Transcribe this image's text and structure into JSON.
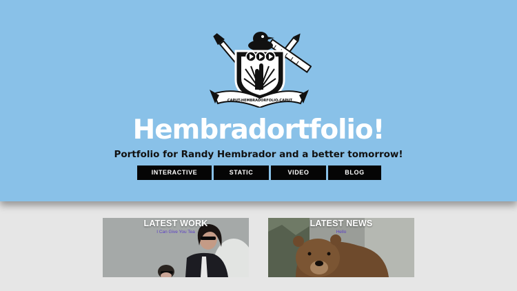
{
  "header": {
    "title": "Hembradortfolio!",
    "tagline": "Portfolio for Randy Hembrador and a better tomorrow!",
    "crest_motto": "CAPUT-HEMBRADORFOLIO-CAPUT"
  },
  "nav": {
    "items": [
      {
        "label": "INTERACTIVE"
      },
      {
        "label": "STATIC"
      },
      {
        "label": "VIDEO"
      },
      {
        "label": "BLOG"
      }
    ]
  },
  "cards": {
    "work": {
      "title": "LATEST WORK",
      "subtitle": "I Can Give You Tea"
    },
    "news": {
      "title": "LATEST NEWS",
      "subtitle": "Hello"
    }
  },
  "colors": {
    "header_bg": "#89c1e8",
    "page_bg": "#e6e6e6",
    "nav_bg": "#050505",
    "title_text": "#ffffff",
    "card_subtitle": "#5a3fc4"
  }
}
